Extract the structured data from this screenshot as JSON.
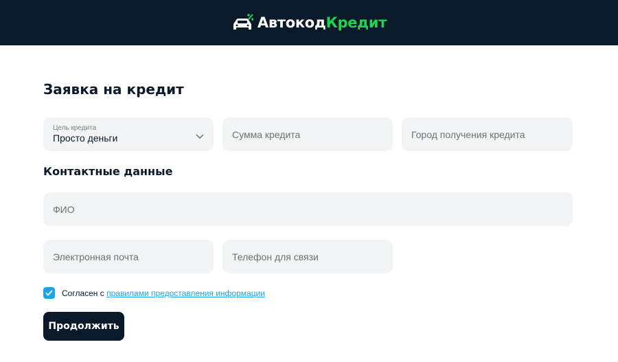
{
  "header": {
    "logo_part1": "Автокод",
    "logo_part2": "Кредит",
    "colors": {
      "background": "#0b1a2a",
      "accent": "#21d24f"
    }
  },
  "form": {
    "title": "Заявка на кредит",
    "purpose": {
      "label": "Цель кредита",
      "value": "Просто деньги"
    },
    "amount_placeholder": "Сумма кредита",
    "city_placeholder": "Город получения кредита",
    "contact_title": "Контактные данные",
    "fio_placeholder": "ФИО",
    "email_placeholder": "Электронная почта",
    "phone_placeholder": "Телефон для связи",
    "agree_text": "Согласен с ",
    "agree_link": "правилами предоставления информации",
    "agree_checked": true,
    "submit_label": "Продолжить"
  },
  "icons": [
    "car-logo-icon",
    "percent-icon",
    "chevron-down-icon",
    "check-icon"
  ],
  "colors": {
    "link": "#1aa5e8",
    "field_bg": "#f3f4f5",
    "button_bg": "#0b1a2a"
  }
}
